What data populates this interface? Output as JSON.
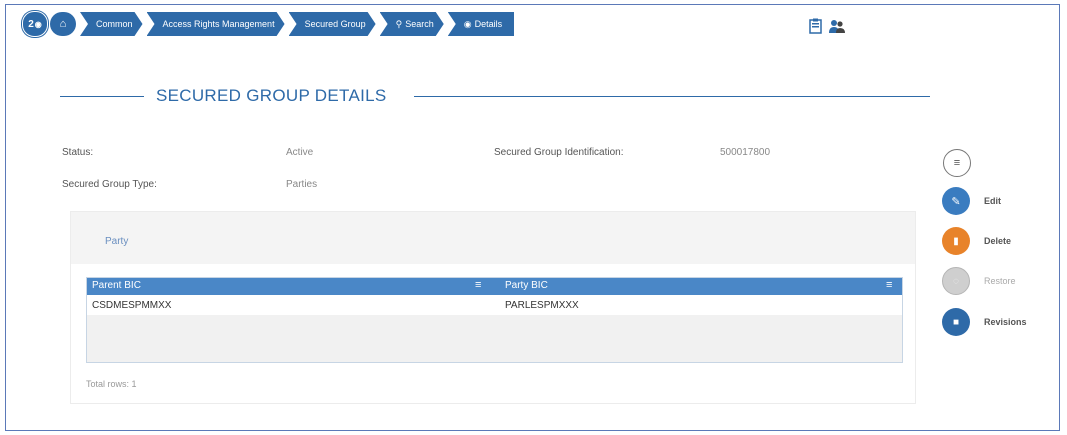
{
  "breadcrumb": {
    "counter": "2",
    "items": [
      "Common",
      "Access Rights Management",
      "Secured Group",
      "Search",
      "Details"
    ]
  },
  "header": {
    "title": "SECURED GROUP DETAILS"
  },
  "details": {
    "status_label": "Status:",
    "status_value": "Active",
    "identification_label": "Secured Group Identification:",
    "identification_value": "500017800",
    "type_label": "Secured Group Type:",
    "type_value": "Parties"
  },
  "party_panel": {
    "tab_label": "Party",
    "columns": [
      "Parent BIC",
      "Party BIC"
    ],
    "rows": [
      [
        "CSDMESPMMXX",
        "PARLESPMXXX"
      ]
    ],
    "total_rows": "Total rows: 1"
  },
  "actions": {
    "edit": "Edit",
    "delete": "Delete",
    "restore": "Restore",
    "revisions": "Revisions"
  },
  "colors": {
    "primary": "#2e6aa8",
    "grid_header": "#4a87c7",
    "delete": "#e8832a",
    "disabled": "#c9c9c9"
  }
}
